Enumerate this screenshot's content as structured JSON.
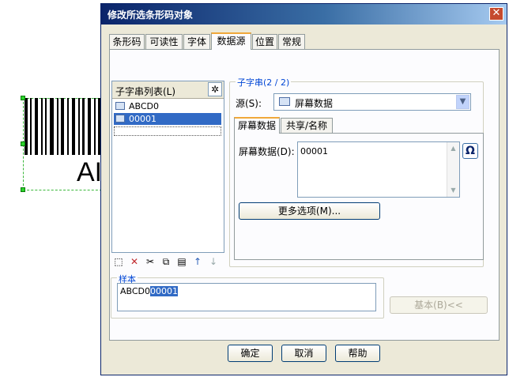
{
  "window": {
    "title": "修改所选条形码对象",
    "close_glyph": "✕"
  },
  "background": {
    "barcode_partial_text": "AI"
  },
  "tabs": [
    {
      "label": "条形码"
    },
    {
      "label": "可读性"
    },
    {
      "label": "字体"
    },
    {
      "label": "数据源",
      "active": true
    },
    {
      "label": "位置"
    },
    {
      "label": "常规"
    }
  ],
  "substring_list": {
    "title": "子字串列表(L)",
    "wand_icon": "magic-wand-icon",
    "items": [
      {
        "label": "ABCD0",
        "selected": false
      },
      {
        "label": "00001",
        "selected": true
      }
    ],
    "toolbar_icons": [
      "new-icon",
      "delete-icon",
      "cut-icon",
      "copy-icon",
      "paste-icon",
      "move-up-icon",
      "move-down-icon"
    ]
  },
  "substring": {
    "title": "子字串(2 / 2)",
    "source_label": "源(S):",
    "source_value": "屏幕数据",
    "subtabs": [
      {
        "label": "屏幕数据",
        "active": true
      },
      {
        "label": "共享/名称"
      }
    ],
    "screen_data_label": "屏幕数据(D):",
    "screen_data_value": "00001",
    "omega_glyph": "Ω",
    "more_options_label": "更多选项(M)..."
  },
  "sample": {
    "title": "样本",
    "prefix": "ABCD0",
    "highlighted": "00001"
  },
  "basic_button": "基本(B)<<",
  "buttons": {
    "ok": "确定",
    "cancel": "取消",
    "help": "帮助"
  },
  "colors": {
    "title_bar": "#0a246a",
    "selection": "#316ac5",
    "group_title": "#0046d5",
    "selection_handle": "#2bd42b"
  }
}
